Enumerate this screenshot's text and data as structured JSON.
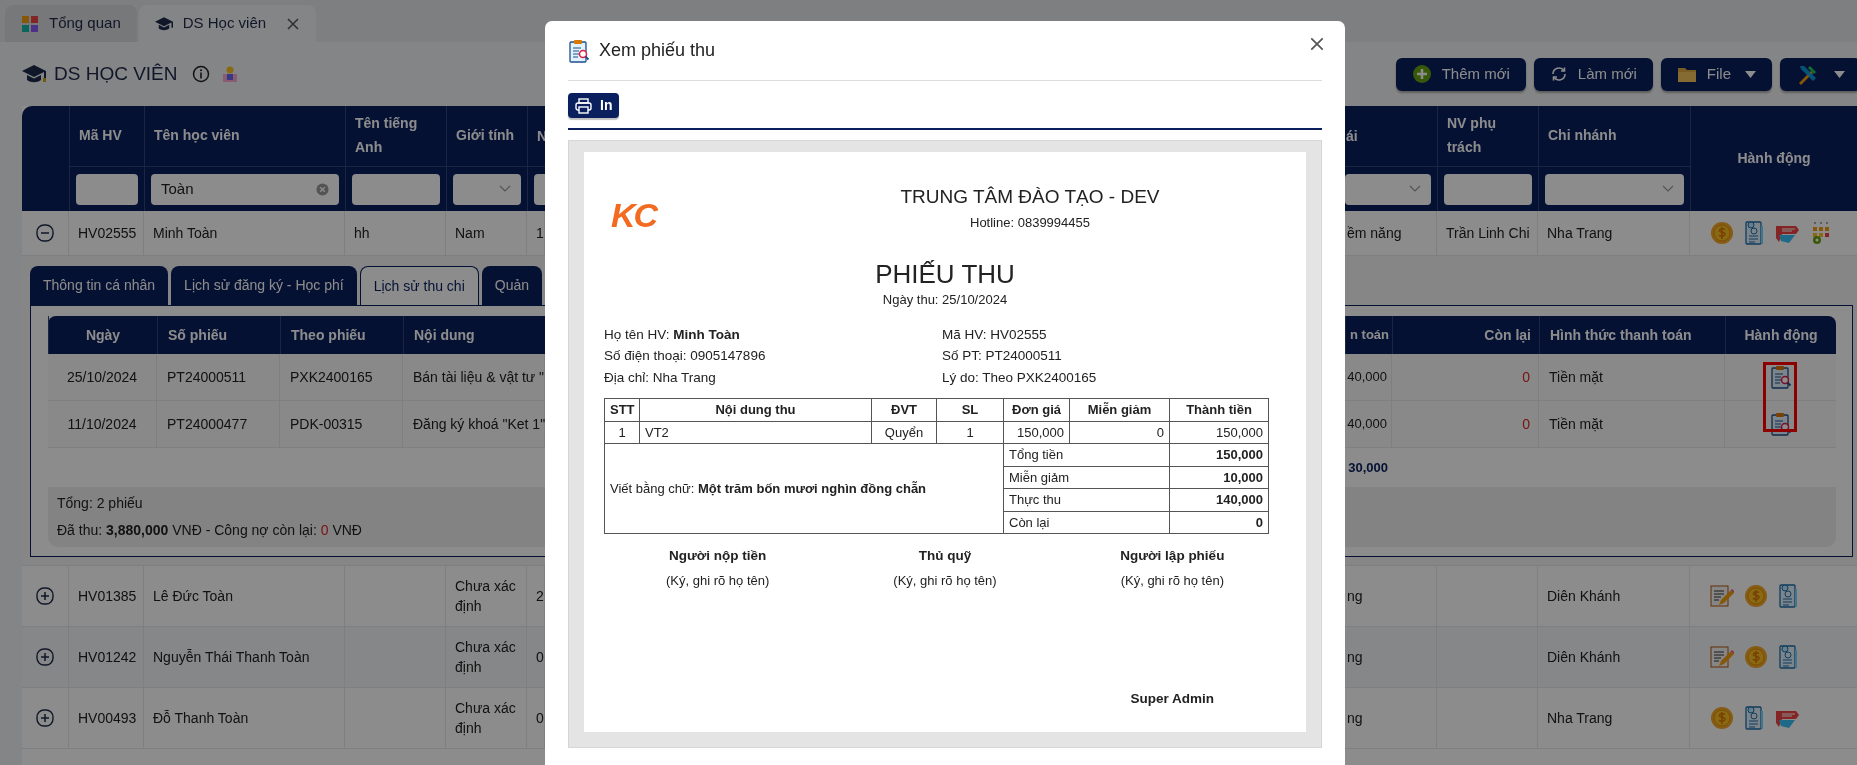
{
  "tabs": [
    {
      "label": "Tổng quan",
      "selected": false,
      "kind": "dashboard"
    },
    {
      "label": "DS Học viên",
      "selected": true,
      "kind": "students",
      "closable": true
    }
  ],
  "page": {
    "title": "DS HỌC VIÊN"
  },
  "toolbar": [
    {
      "kind": "add",
      "label": "Thêm mới",
      "dropdown": false
    },
    {
      "kind": "refresh",
      "label": "Làm mới",
      "dropdown": false
    },
    {
      "kind": "file",
      "label": "File",
      "dropdown": true
    },
    {
      "kind": "tools",
      "dropdown": true
    }
  ],
  "students_table": {
    "columns": [
      {
        "label": "Mã HV",
        "filter": {
          "kind": "text"
        }
      },
      {
        "label": "Tên học viên",
        "filter": {
          "kind": "text",
          "value": "Toàn",
          "clearable": true
        }
      },
      {
        "label": "Tên tiếng Anh",
        "filter": {
          "kind": "text"
        }
      },
      {
        "label": "Giới tính",
        "filter": {
          "kind": "select"
        }
      },
      {
        "label": "N",
        "filter": {
          "kind": "text"
        }
      },
      {
        "label": "ái",
        "filter": {
          "kind": "select"
        }
      },
      {
        "label": "NV phụ trách",
        "filter": {
          "kind": "text"
        }
      },
      {
        "label": "Chi nhánh",
        "filter": {
          "kind": "select"
        }
      },
      {
        "label": "Hành động"
      }
    ],
    "rows": [
      {
        "expanded": true,
        "cells": [
          "HV02555",
          "Minh Toàn",
          "hh",
          "Nam",
          "1",
          "ềm năng",
          "Trần Linh Chi",
          "Nha Trang"
        ],
        "actions": [
          {
            "kind": "coin"
          },
          {
            "kind": "document"
          },
          {
            "kind": "tag"
          },
          {
            "kind": "keypad"
          }
        ],
        "details": {
          "tabs": [
            {
              "label": "Thông tin cá nhân",
              "selected": false
            },
            {
              "label": "Lịch sử đăng ký - Học phí",
              "selected": false
            },
            {
              "label": "Lịch sử thu chi",
              "selected": true
            },
            {
              "label": "Quản",
              "selected": false
            }
          ],
          "columns": [
            "Ngày",
            "Số phiếu",
            "Theo phiếu",
            "Nội dung",
            "n toán",
            "Còn lại",
            "Hình thức thanh toán",
            "Hành động"
          ],
          "rows": [
            {
              "cells": [
                "25/10/2024",
                "PT24000511",
                "PXK2400165",
                "Bán tài liệu & vật tư \"",
                "40,000",
                "0",
                "Tiền mặt"
              ]
            },
            {
              "cells": [
                "11/10/2024",
                "PT24000477",
                "PDK-00315",
                "Đăng ký khoá \"Ket 1\"",
                "40,000",
                "0",
                "Tiền mặt"
              ]
            }
          ],
          "actions_highlighted": true,
          "total": "30,000",
          "footer": {
            "count": "Tổng: 2 phiếu",
            "paid": "Đã thu: **3,880,000** VNĐ - Công nợ còn lại:",
            "debt": "0",
            "currency": "VNĐ"
          }
        }
      },
      {
        "expanded": false,
        "cells": [
          "HV01385",
          "Lê Đức Toàn",
          null,
          "Chưa xác định",
          "2",
          "ng",
          null,
          "Diên Khánh"
        ],
        "actions": [
          {
            "kind": "edit"
          },
          {
            "kind": "coin"
          },
          {
            "kind": "document"
          }
        ]
      },
      {
        "expanded": false,
        "cells": [
          "HV01242",
          "Nguyễn Thái Thanh Toàn",
          null,
          "Chưa xác định",
          "0",
          "ng",
          null,
          "Diên Khánh"
        ],
        "actions": [
          {
            "kind": "edit"
          },
          {
            "kind": "coin"
          },
          {
            "kind": "document"
          }
        ]
      },
      {
        "expanded": false,
        "cells": [
          "HV00493",
          "Đỗ Thanh Toàn",
          null,
          "Chưa xác định",
          "0",
          "ng",
          null,
          "Nha Trang"
        ],
        "actions": [
          {
            "kind": "coin"
          },
          {
            "kind": "document"
          },
          {
            "kind": "tag"
          }
        ]
      }
    ]
  },
  "modal": {
    "title": "Xem phiếu thu",
    "print_button": "In",
    "receipt": {
      "logo": "KC",
      "org": "TRUNG TÂM ĐÀO TẠO - DEV",
      "hotline": "Hotline: 0839994455",
      "title": "PHIẾU THU",
      "date": "Ngày thu: 25/10/2024",
      "info_left": [
        "Họ tên HV: **Minh Toàn**",
        "Số điện thoại: 0905147896",
        "Địa chỉ: Nha Trang"
      ],
      "info_right": [
        "Mã HV: HV02555",
        "Số PT: PT24000511",
        "Lý do: Theo PXK2400165"
      ],
      "columns": [
        "STT",
        "Nội dung thu",
        "ĐVT",
        "SL",
        "Đơn giá",
        "Miễn giảm",
        "Thành tiền"
      ],
      "items": [
        [
          "1",
          "VT2",
          "Quyển",
          "1",
          "150,000",
          "0",
          "150,000"
        ]
      ],
      "amount_in_words": "Viết bằng chữ: **Một trăm bốn mươi nghìn đồng chẵn**",
      "totals": [
        {
          "label": "Tổng tiền",
          "value": "150,000"
        },
        {
          "label": "Miễn giảm",
          "value": "10,000"
        },
        {
          "label": "Thực thu",
          "value": "140,000"
        },
        {
          "label": "Còn lại",
          "value": "0"
        }
      ],
      "signatures": [
        {
          "role": "Người nộp tiền",
          "hint": "(Ký, ghi rõ họ tên)"
        },
        {
          "role": "Thủ quỹ",
          "hint": "(Ký, ghi rõ họ tên)"
        },
        {
          "role": "Người lập phiếu",
          "hint": "(Ký, ghi rõ họ tên)",
          "signer": "Super Admin"
        }
      ]
    }
  }
}
